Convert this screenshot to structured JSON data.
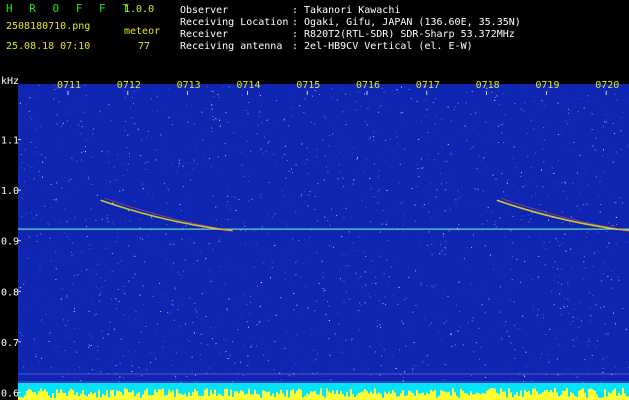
{
  "header": {
    "brand": "H R O F F T",
    "version": "1.0.0",
    "filename": "2508180710.png",
    "datetime": "25.08.18 07:10",
    "meteor_label": "meteor",
    "meteor_count": "77"
  },
  "info": {
    "rows": [
      {
        "label": "Observer",
        "value": ": Takanori Kawachi"
      },
      {
        "label": "Receiving Location",
        "value": ": Ogaki, Gifu, JAPAN (136.60E, 35.35N)"
      },
      {
        "label": "Receiver",
        "value": ": R820T2(RTL-SDR) SDR-Sharp 53.372MHz"
      },
      {
        "label": "Receiving antenna",
        "value": ": 2el-HB9CV Vertical (el. E-W)"
      }
    ]
  },
  "chart_data": {
    "type": "heatmap",
    "ylabel": "kHz",
    "x_ticks": [
      "0711",
      "0712",
      "0713",
      "0714",
      "0715",
      "0716",
      "0717",
      "0718",
      "0719",
      "0720"
    ],
    "y_ticks": [
      "1.1",
      "1.0",
      "0.9",
      "0.8",
      "0.7",
      "0.6"
    ],
    "y_tick_values": [
      1.1,
      1.0,
      0.9,
      0.8,
      0.7,
      0.6
    ],
    "ylim": [
      0.585,
      1.21
    ],
    "carrier_khz": 0.923,
    "meteor_traces": [
      {
        "x": [
          7.12,
          7.14
        ],
        "y": [
          0.98,
          0.92
        ]
      },
      {
        "x": [
          7.18,
          7.2
        ],
        "y": [
          0.98,
          0.92
        ]
      }
    ],
    "colors": {
      "background": "#000000",
      "noise_base": "#0f26b3",
      "trace": "#e6e619",
      "axis_text": "#ffffff",
      "tick_text": "#e6e619",
      "brand": "#19e619"
    }
  }
}
